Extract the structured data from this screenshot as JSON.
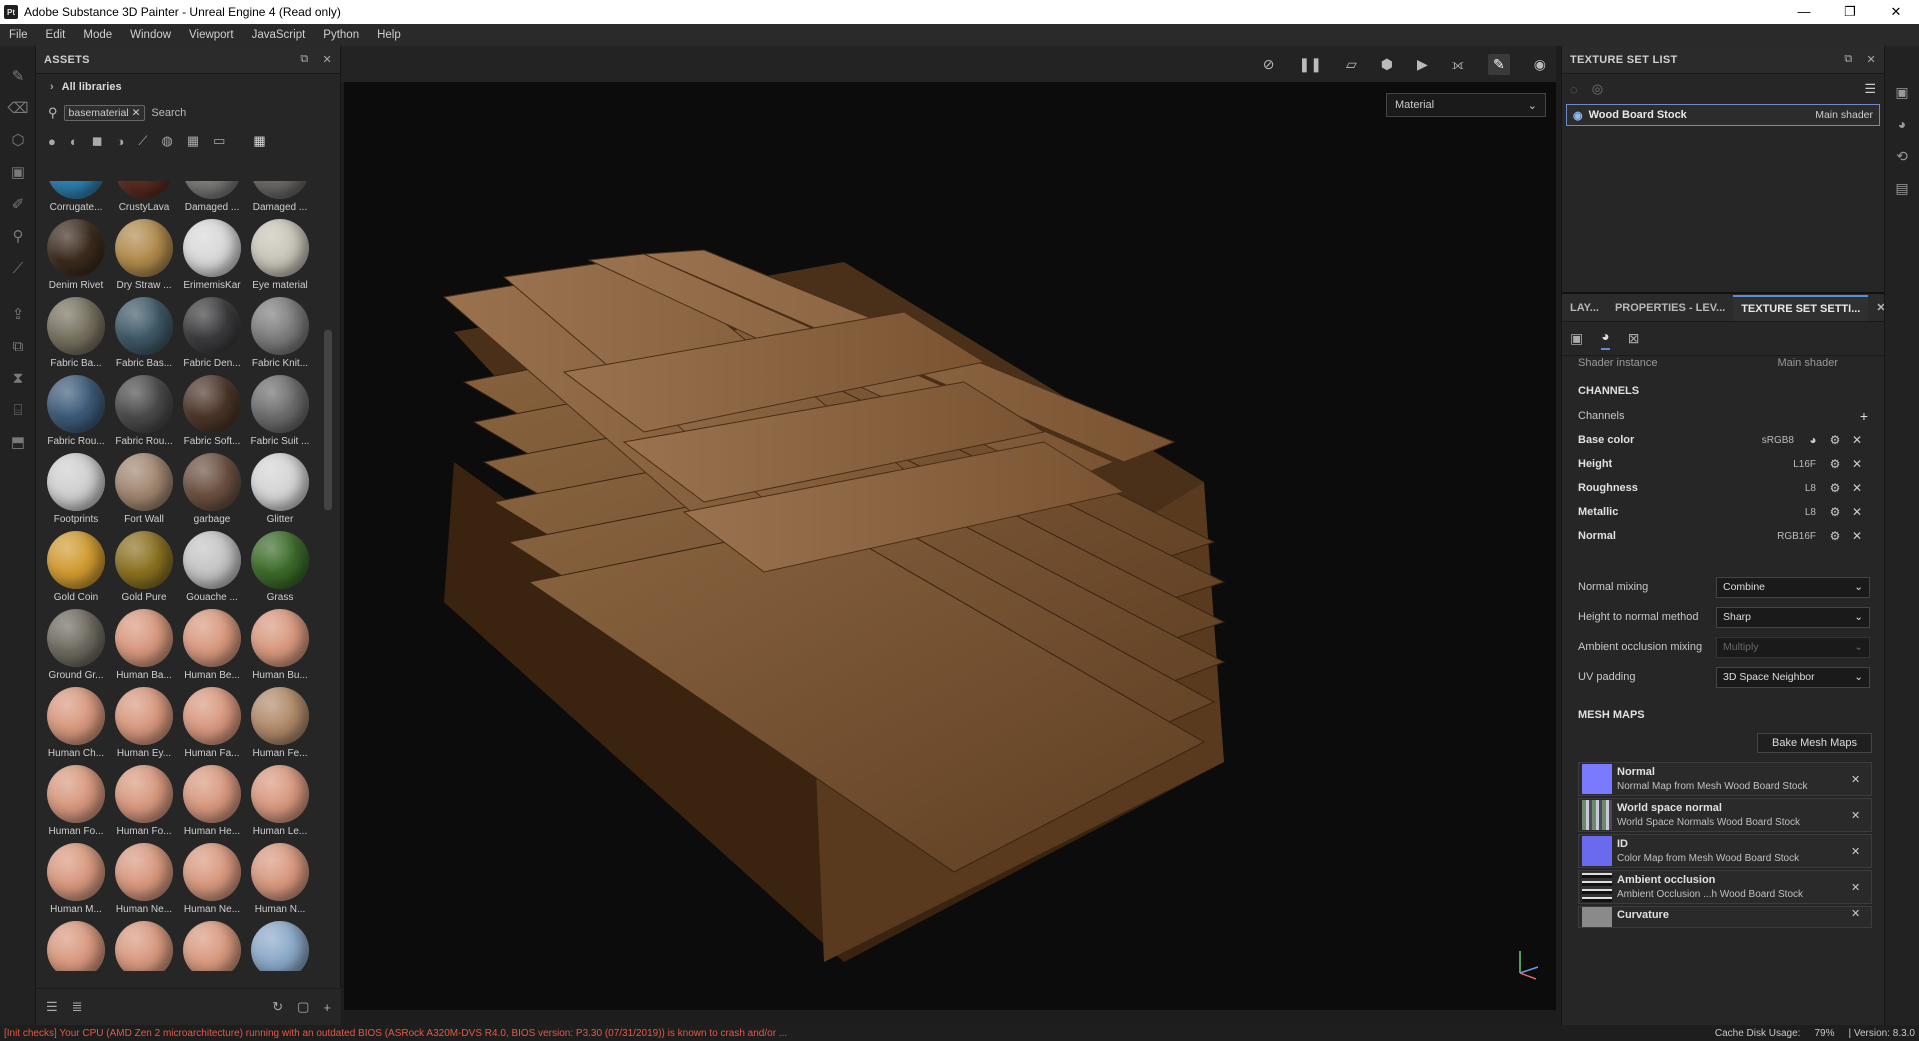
{
  "window": {
    "title": "Adobe Substance 3D Painter - Unreal Engine 4 (Read only)",
    "logo": "Pt",
    "controls": [
      "—",
      "❐",
      "✕"
    ]
  },
  "menu": [
    "File",
    "Edit",
    "Mode",
    "Window",
    "Viewport",
    "JavaScript",
    "Python",
    "Help"
  ],
  "assets": {
    "title": "ASSETS",
    "libraries": "All libraries",
    "search_tag": "basematerial",
    "search_placeholder": "Search",
    "items": [
      {
        "label": "Corrugate...",
        "color": "#2d7fb0"
      },
      {
        "label": "CrustyLava",
        "color": "#5a2a20"
      },
      {
        "label": "Damaged ...",
        "color": "#7a7a78"
      },
      {
        "label": "Damaged ...",
        "color": "#6a6866"
      },
      {
        "label": "Denim Rivet",
        "color": "#3a2a1c"
      },
      {
        "label": "Dry Straw ...",
        "color": "#b08a4c"
      },
      {
        "label": "ErimemisKar",
        "color": "#d8d8d8"
      },
      {
        "label": "Eye material",
        "color": "#c8c4b8"
      },
      {
        "label": "Fabric Ba...",
        "color": "#76705e"
      },
      {
        "label": "Fabric Bas...",
        "color": "#3e5866"
      },
      {
        "label": "Fabric Den...",
        "color": "#3a3a3c"
      },
      {
        "label": "Fabric Knit...",
        "color": "#7c7c7c"
      },
      {
        "label": "Fabric Rou...",
        "color": "#3c5a78"
      },
      {
        "label": "Fabric Rou...",
        "color": "#4a4a4a"
      },
      {
        "label": "Fabric Soft...",
        "color": "#4a3428"
      },
      {
        "label": "Fabric Suit ...",
        "color": "#6c6c6c"
      },
      {
        "label": "Footprints",
        "color": "#cfcfcf"
      },
      {
        "label": "Fort Wall",
        "color": "#a08670"
      },
      {
        "label": "garbage",
        "color": "#6a5040"
      },
      {
        "label": "Glitter",
        "color": "#d4d4d4"
      },
      {
        "label": "Gold Coin",
        "color": "#d09a30"
      },
      {
        "label": "Gold Pure",
        "color": "#8a7020"
      },
      {
        "label": "Gouache ...",
        "color": "#c4c4c4"
      },
      {
        "label": "Grass",
        "color": "#3a6a28"
      },
      {
        "label": "Ground Gr...",
        "color": "#6e6a60"
      },
      {
        "label": "Human Ba...",
        "color": "#d8987e"
      },
      {
        "label": "Human Be...",
        "color": "#d8987e"
      },
      {
        "label": "Human Bu...",
        "color": "#d8987e"
      },
      {
        "label": "Human Ch...",
        "color": "#d8987e"
      },
      {
        "label": "Human Ey...",
        "color": "#d8987e"
      },
      {
        "label": "Human Fa...",
        "color": "#d8987e"
      },
      {
        "label": "Human Fe...",
        "color": "#b08a6a"
      },
      {
        "label": "Human Fo...",
        "color": "#d8987e"
      },
      {
        "label": "Human Fo...",
        "color": "#d8987e"
      },
      {
        "label": "Human He...",
        "color": "#d8987e"
      },
      {
        "label": "Human Le...",
        "color": "#d8987e"
      },
      {
        "label": "Human M...",
        "color": "#d8987e"
      },
      {
        "label": "Human Ne...",
        "color": "#d8987e"
      },
      {
        "label": "Human Ne...",
        "color": "#d8987e"
      },
      {
        "label": "Human N...",
        "color": "#d8987e"
      },
      {
        "label": "",
        "color": "#d8987e"
      },
      {
        "label": "",
        "color": "#d8987e"
      },
      {
        "label": "",
        "color": "#d8987e"
      },
      {
        "label": "",
        "color": "#8aa8c8"
      }
    ]
  },
  "viewport": {
    "material_mode": "Material"
  },
  "texture_set_list": {
    "title": "TEXTURE SET LIST",
    "item": {
      "name": "Wood Board Stock",
      "shader": "Main shader"
    }
  },
  "texture_set_settings": {
    "tabs": [
      "LAY...",
      "PROPERTIES - LEV...",
      "TEXTURE SET SETTI..."
    ],
    "shader_instance_label": "Shader instance",
    "shader_instance_value": "Main shader",
    "channels_header": "CHANNELS",
    "channels_label": "Channels",
    "channels": [
      {
        "name": "Base color",
        "format": "sRGB8"
      },
      {
        "name": "Height",
        "format": "L16F"
      },
      {
        "name": "Roughness",
        "format": "L8"
      },
      {
        "name": "Metallic",
        "format": "L8"
      },
      {
        "name": "Normal",
        "format": "RGB16F"
      }
    ],
    "settings": [
      {
        "label": "Normal mixing",
        "value": "Combine",
        "disabled": false
      },
      {
        "label": "Height to normal method",
        "value": "Sharp",
        "disabled": false
      },
      {
        "label": "Ambient occlusion mixing",
        "value": "Multiply",
        "disabled": true
      },
      {
        "label": "UV padding",
        "value": "3D Space Neighbor",
        "disabled": false
      }
    ],
    "mesh_maps_header": "MESH MAPS",
    "bake_button": "Bake Mesh Maps",
    "mesh_maps": [
      {
        "name": "Normal",
        "desc": "Normal Map from Mesh Wood Board Stock",
        "thumb": "#7a7aff"
      },
      {
        "name": "World space normal",
        "desc": "World Space Normals Wood Board Stock",
        "thumb": "#8a9a8a"
      },
      {
        "name": "ID",
        "desc": "Color Map from Mesh Wood Board Stock",
        "thumb": "#6a6aee"
      },
      {
        "name": "Ambient occlusion",
        "desc": "Ambient Occlusion ...h Wood Board Stock",
        "thumb": "#2a2a2a"
      },
      {
        "name": "Curvature",
        "desc": "",
        "thumb": "#8a8a8a"
      }
    ]
  },
  "status": {
    "message": "[Init checks] Your CPU (AMD Zen 2 microarchitecture) running with an outdated BIOS (ASRock A320M-DVS R4.0, BIOS version: P3.30 (07/31/2019)) is known to crash and/or ...",
    "cache": "Cache Disk Usage:",
    "cache_value": "79%",
    "version": "| Version: 8.3.0"
  }
}
